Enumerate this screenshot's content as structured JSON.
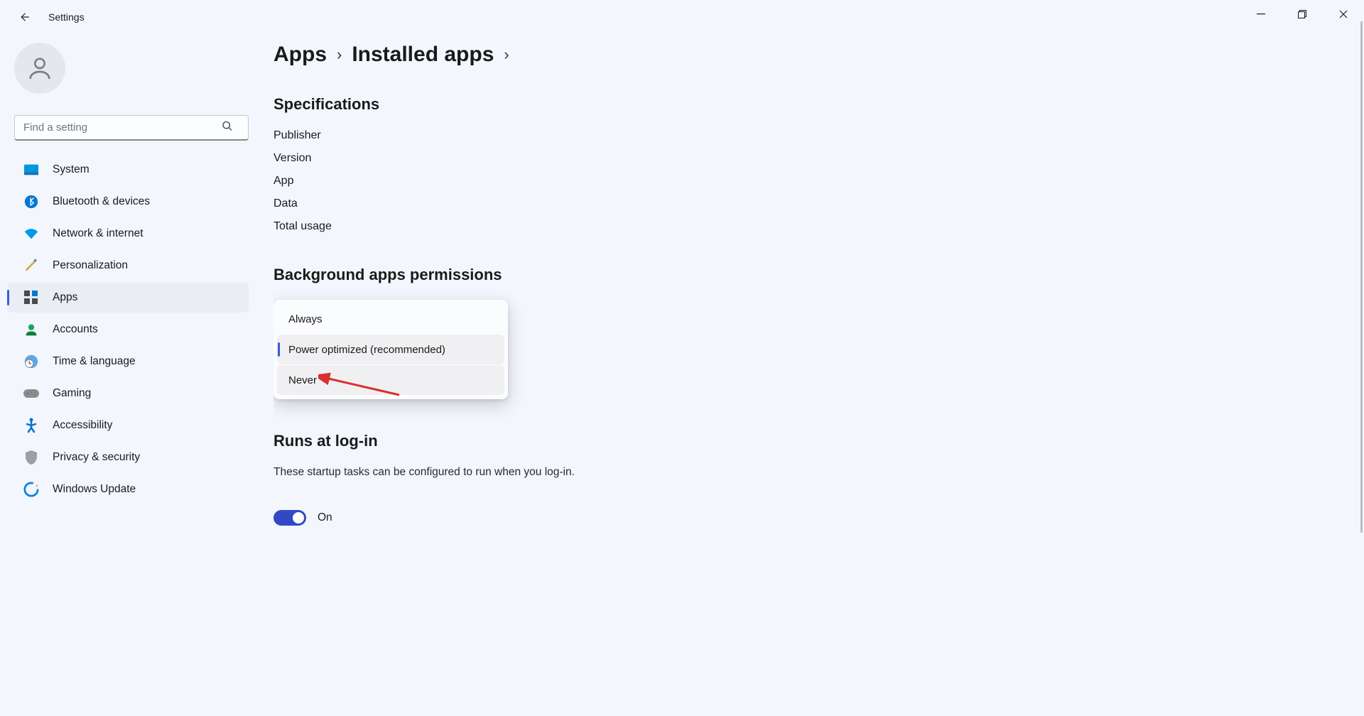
{
  "titlebar": {
    "title": "Settings"
  },
  "search": {
    "placeholder": "Find a setting"
  },
  "sidebar": {
    "items": [
      {
        "label": "System"
      },
      {
        "label": "Bluetooth & devices"
      },
      {
        "label": "Network & internet"
      },
      {
        "label": "Personalization"
      },
      {
        "label": "Apps"
      },
      {
        "label": "Accounts"
      },
      {
        "label": "Time & language"
      },
      {
        "label": "Gaming"
      },
      {
        "label": "Accessibility"
      },
      {
        "label": "Privacy & security"
      },
      {
        "label": "Windows Update"
      }
    ]
  },
  "breadcrumb": {
    "level1": "Apps",
    "level2": "Installed apps"
  },
  "specs": {
    "heading": "Specifications",
    "rows": [
      "Publisher",
      "Version",
      "App",
      "Data",
      "Total usage"
    ]
  },
  "bgperms": {
    "heading": "Background apps permissions",
    "options": [
      "Always",
      "Power optimized (recommended)",
      "Never"
    ]
  },
  "runs": {
    "heading": "Runs at log-in",
    "description": "These startup tasks can be configured to run when you log-in.",
    "toggle_label": "On"
  }
}
